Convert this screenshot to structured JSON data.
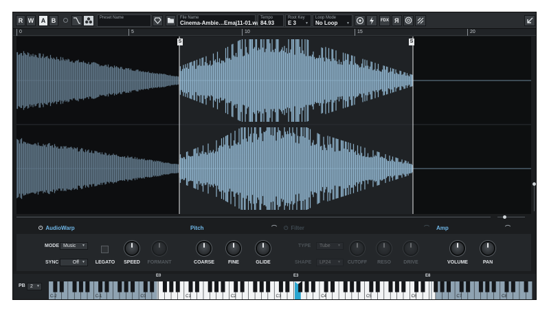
{
  "toolbar": {
    "r_label": "R",
    "w_label": "W",
    "a_label": "A",
    "b_label": "B",
    "preset": {
      "label": "Preset Name",
      "value": ""
    },
    "file": {
      "label": "File Name",
      "value": "Cinema-Ambie…Emaj11-01.wav"
    },
    "tempo": {
      "label": "Tempo",
      "value": "84.93"
    },
    "root_key": {
      "label": "Root Key",
      "value": "E 3"
    },
    "loop_mode": {
      "label": "Loop Mode",
      "value": "No Loop"
    },
    "fdx_label": "FDX",
    "reverse_label": "R"
  },
  "ruler": {
    "marks": [
      "0",
      "5",
      "10",
      "15",
      "20"
    ]
  },
  "waveform": {
    "start_marker": "S",
    "end_marker": "S"
  },
  "sections": {
    "audiowarp": "AudioWarp",
    "pitch": "Pitch",
    "filter": "Filter",
    "amp": "Amp"
  },
  "audiowarp": {
    "mode_label": "MODE",
    "mode_value": "Music",
    "sync_label": "SYNC",
    "sync_value": "Off",
    "legato_label": "LEGATO",
    "speed_label": "SPEED",
    "formant_label": "FORMANT"
  },
  "pitch": {
    "coarse_label": "COARSE",
    "fine_label": "FINE",
    "glide_label": "GLIDE"
  },
  "filter": {
    "type_label": "TYPE",
    "type_value": "Tube",
    "shape_label": "SHAPE",
    "shape_value": "LP24",
    "cutoff_label": "CUTOFF",
    "reso_label": "RESO",
    "drive_label": "DRIVE"
  },
  "amp": {
    "volume_label": "VOLUME",
    "pan_label": "PAN"
  },
  "keyboard": {
    "pb_label": "PB",
    "pb_value": "2",
    "range_low": "E0",
    "root": "E3",
    "range_high": "E8",
    "octave_labels": [
      "C-2",
      "C-1",
      "C0",
      "C1",
      "C2",
      "C3",
      "C4",
      "C5",
      "C6",
      "C7",
      "C8"
    ]
  },
  "colors": {
    "accent": "#6fb6e6",
    "waveform_active": "#8fb3cc",
    "waveform_inactive": "#5f7d92",
    "background": "#1b1d1f"
  }
}
